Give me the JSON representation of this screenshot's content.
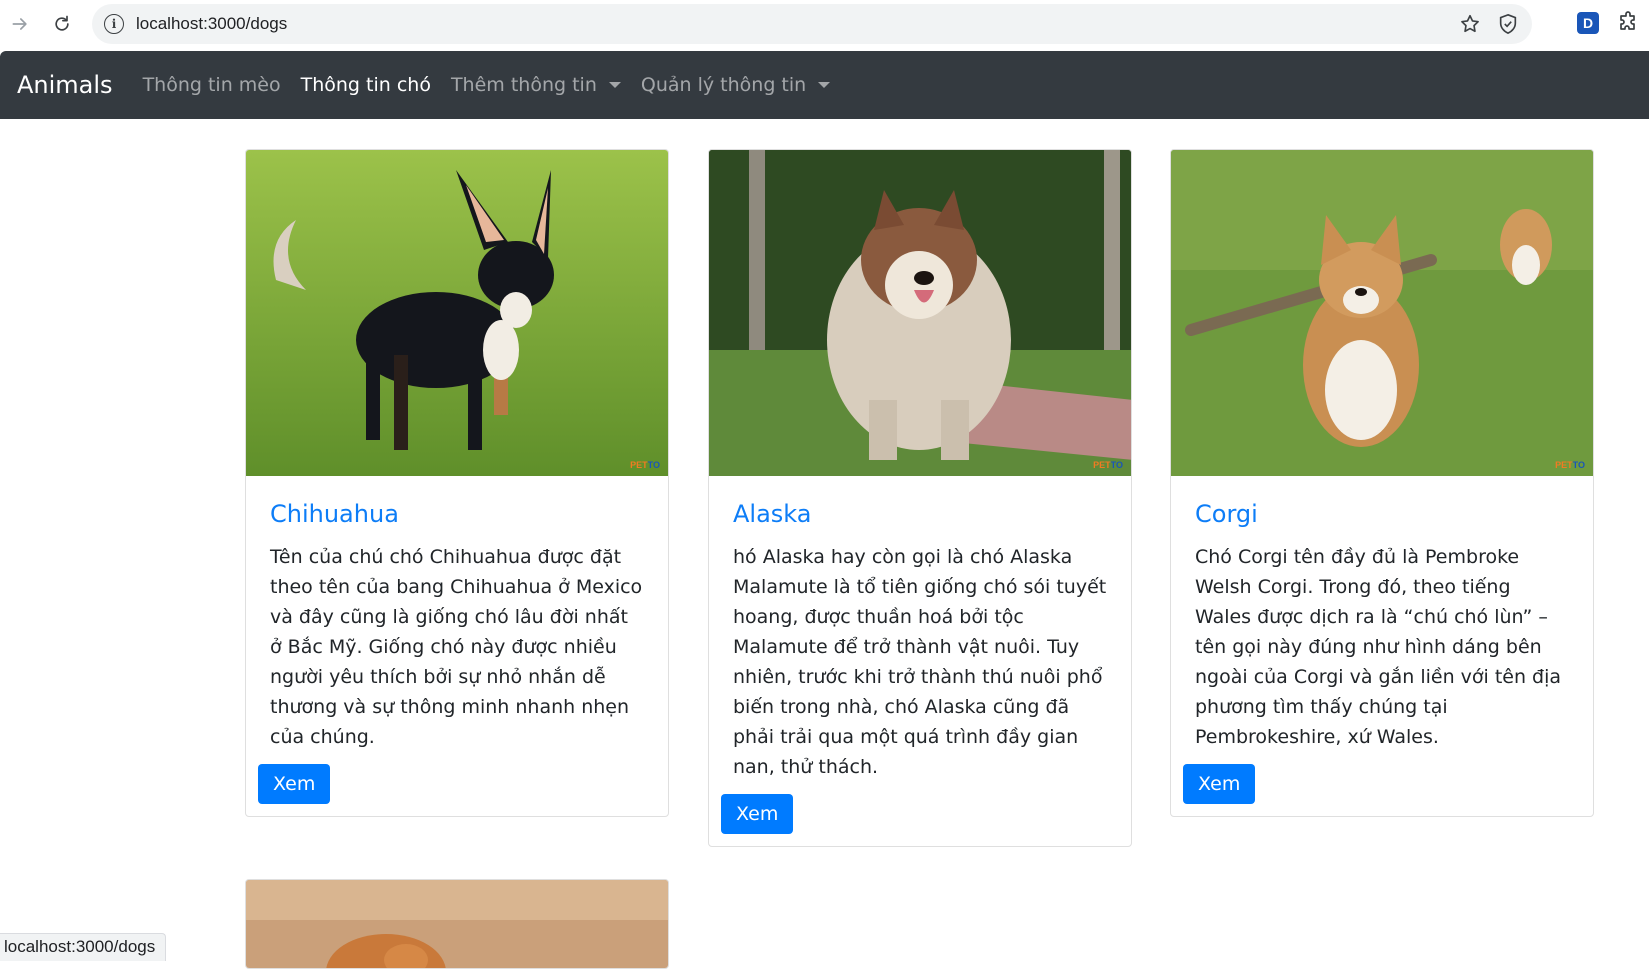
{
  "browser": {
    "url": "localhost:3000/dogs"
  },
  "navbar": {
    "brand": "Animals",
    "links": [
      {
        "label": "Thông tin mèo",
        "active": false
      },
      {
        "label": "Thông tin chó",
        "active": true
      },
      {
        "label": "Thêm thông tin",
        "dropdown": true
      },
      {
        "label": "Quản lý thông tin",
        "dropdown": true
      }
    ]
  },
  "cards": [
    {
      "title": "Chihuahua",
      "text": "Tên của chú chó Chihuahua được đặt theo tên của bang Chihuahua ở Mexico và đây cũng là giống chó lâu đời nhất ở Bắc Mỹ. Giống chó này được nhiều người yêu thích bởi sự nhỏ nhắn dễ thương và sự thông minh nhanh nhẹn của chúng.",
      "button": "Xem"
    },
    {
      "title": "Alaska",
      "text": "hó Alaska hay còn gọi là chó Alaska Malamute là tổ tiên giống chó sói tuyết hoang, được thuần hoá bởi tộc Malamute để trở thành vật nuôi. Tuy nhiên, trước khi trở thành thú nuôi phổ biến trong nhà, chó Alaska cũng đã phải trải qua một quá trình đầy gian nan, thử thách.",
      "button": "Xem"
    },
    {
      "title": "Corgi",
      "text": "Chó Corgi tên đầy đủ là Pembroke Welsh Corgi. Trong đó, theo tiếng Wales được dịch ra là “chú chó lùn” – tên gọi này đúng như hình dáng bên ngoài của Corgi và gắn liền với tên địa phương tìm thấy chúng tại Pembrokeshire, xứ Wales.",
      "button": "Xem"
    }
  ],
  "watermark": {
    "pet": "PET",
    "to": "TO"
  },
  "status_bar": "localhost:3000/dogs"
}
